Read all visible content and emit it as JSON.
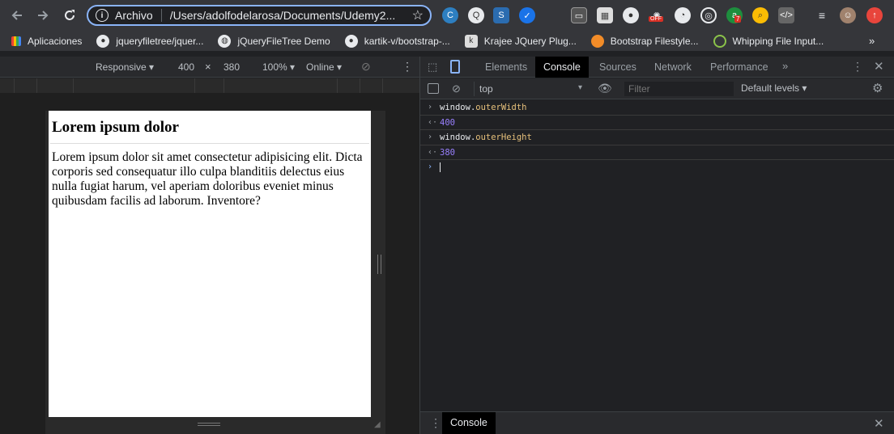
{
  "browser": {
    "address_scheme": "Archivo",
    "address_url": "/Users/adolfodelarosa/Documents/Udemy2...",
    "ext_badge": "7",
    "ext_off": "OFF"
  },
  "bookmarks": [
    {
      "label": "Aplicaciones"
    },
    {
      "label": "jqueryfiletree/jquer..."
    },
    {
      "label": "jQueryFileTree Demo"
    },
    {
      "label": "kartik-v/bootstrap-..."
    },
    {
      "label": "Krajee JQuery Plug..."
    },
    {
      "label": "Bootstrap Filestyle..."
    },
    {
      "label": "Whipping File Input..."
    }
  ],
  "device_toolbar": {
    "mode": "Responsive",
    "width": "400",
    "times": "×",
    "height": "380",
    "zoom": "100%",
    "network": "Online"
  },
  "page": {
    "heading": "Lorem ipsum dolor",
    "body": "Lorem ipsum dolor sit amet consectetur adipisicing elit. Dicta corporis sed consequatur illo culpa blanditiis delectus eius nulla fugiat harum, vel aperiam doloribus eveniet minus quibusdam facilis ad laborum. Inventore?"
  },
  "devtools": {
    "tabs": [
      "Elements",
      "Console",
      "Sources",
      "Network",
      "Performance"
    ],
    "active_tab": "Console",
    "context": "top",
    "filter_placeholder": "Filter",
    "levels": "Default levels",
    "drawer_tab": "Console"
  },
  "console": {
    "entries": [
      {
        "obj": "window",
        "prop": "outerWidth",
        "result": "400"
      },
      {
        "obj": "window",
        "prop": "outerHeight",
        "result": "380"
      }
    ]
  }
}
